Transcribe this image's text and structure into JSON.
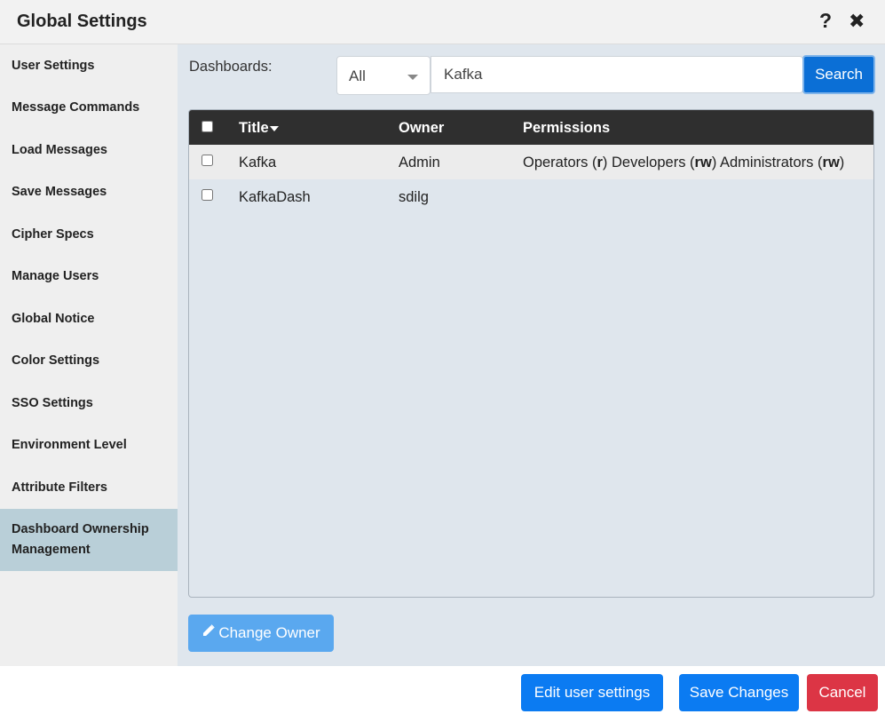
{
  "dialog": {
    "title": "Global Settings",
    "help_glyph": "?",
    "close_glyph": "✖"
  },
  "sidebar": {
    "items": [
      {
        "label": "User Settings",
        "active": false
      },
      {
        "label": "Message Commands",
        "active": false
      },
      {
        "label": "Load Messages",
        "active": false
      },
      {
        "label": "Save Messages",
        "active": false
      },
      {
        "label": "Cipher Specs",
        "active": false
      },
      {
        "label": "Manage Users",
        "active": false
      },
      {
        "label": "Global Notice",
        "active": false
      },
      {
        "label": "Color Settings",
        "active": false
      },
      {
        "label": "SSO Settings",
        "active": false
      },
      {
        "label": "Environment Level",
        "active": false
      },
      {
        "label": "Attribute Filters",
        "active": false
      },
      {
        "label": "Dashboard Ownership Management",
        "active": true
      }
    ]
  },
  "main": {
    "dashboards_label": "Dashboards:",
    "filter_select": {
      "value": "All"
    },
    "search": {
      "value": "Kafka",
      "button_label": "Search"
    },
    "table": {
      "columns": [
        "Title",
        "Owner",
        "Permissions"
      ],
      "sort_column": "Title",
      "rows": [
        {
          "title": "Kafka",
          "owner": "Admin",
          "permissions": [
            {
              "group": "Operators",
              "access": "r"
            },
            {
              "group": "Developers",
              "access": "rw"
            },
            {
              "group": "Administrators",
              "access": "rw"
            }
          ],
          "checked": false
        },
        {
          "title": "KafkaDash",
          "owner": "sdilg",
          "permissions": [],
          "checked": false
        }
      ]
    },
    "change_owner_label": "Change Owner",
    "pencil_icon": "pencil-icon"
  },
  "footer": {
    "edit_user_settings_label": "Edit user settings",
    "save_changes_label": "Save Changes",
    "cancel_label": "Cancel"
  },
  "colors": {
    "header_bg": "#f2f2f2",
    "sidebar_bg": "#efefef",
    "sidebar_active_bg": "#b9cfd8",
    "main_bg": "#dfe6ed",
    "table_header_bg": "#2f2f2f",
    "primary": "#0b7bf2",
    "primary_light": "#5aa8ef",
    "danger": "#dc3545"
  }
}
